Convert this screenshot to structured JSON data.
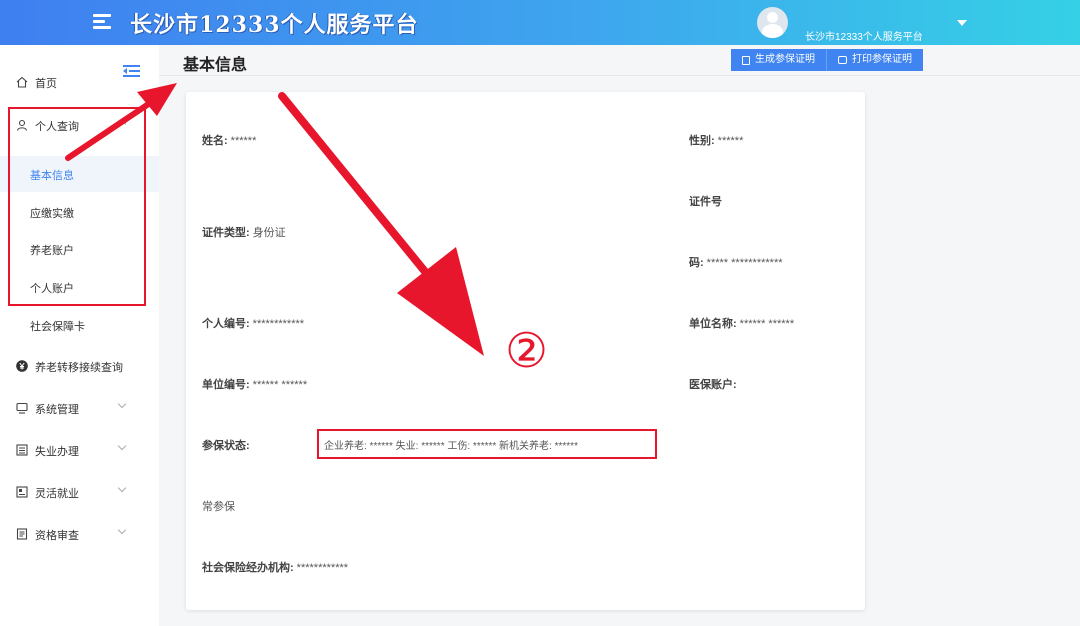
{
  "header": {
    "app_title": "长沙市12333个人服务平台",
    "user_name": "长沙市12333个人服务平台"
  },
  "sidebar": {
    "items": [
      {
        "label": "首页",
        "icon": "home-icon"
      },
      {
        "label": "个人查询",
        "icon": "user-icon"
      },
      {
        "label": "养老转移接续查询",
        "icon": "yen-icon"
      },
      {
        "label": "系统管理",
        "icon": "monitor-icon"
      },
      {
        "label": "失业办理",
        "icon": "calendar-icon"
      },
      {
        "label": "灵活就业",
        "icon": "id-card-icon"
      },
      {
        "label": "资格审查",
        "icon": "document-icon"
      }
    ],
    "sub_items": [
      "基本信息",
      "应缴实缴",
      "养老账户",
      "个人账户",
      "社会保障卡"
    ]
  },
  "titlebar": {
    "title": "基本信息",
    "btn_generate": "生成参保证明",
    "btn_print": "打印参保证明"
  },
  "info": {
    "name_label": "姓名:",
    "name_value": "******",
    "gender_label": "性别:",
    "gender_value": "******",
    "id_type_label": "证件类型:",
    "id_type_value": "身份证",
    "id_no_label_1": "证件号",
    "id_no_label_2": "码:",
    "id_no_value": "***** ************",
    "personal_no_label": "个人编号:",
    "personal_no_value": "************",
    "unit_name_label": "单位名称:",
    "unit_name_value": "****** ******",
    "unit_no_label": "单位编号:",
    "unit_no_value": "****** ******",
    "medical_label": "医保账户:",
    "status_label": "参保状态:",
    "status_value": "企业养老: ****** 失业: ****** 工伤: ****** 新机关养老: ******",
    "status_extra": "常参保",
    "agency_label": "社会保险经办机构:",
    "agency_value": "************"
  },
  "annotation": {
    "number": "②",
    "color": "#e8162c"
  }
}
